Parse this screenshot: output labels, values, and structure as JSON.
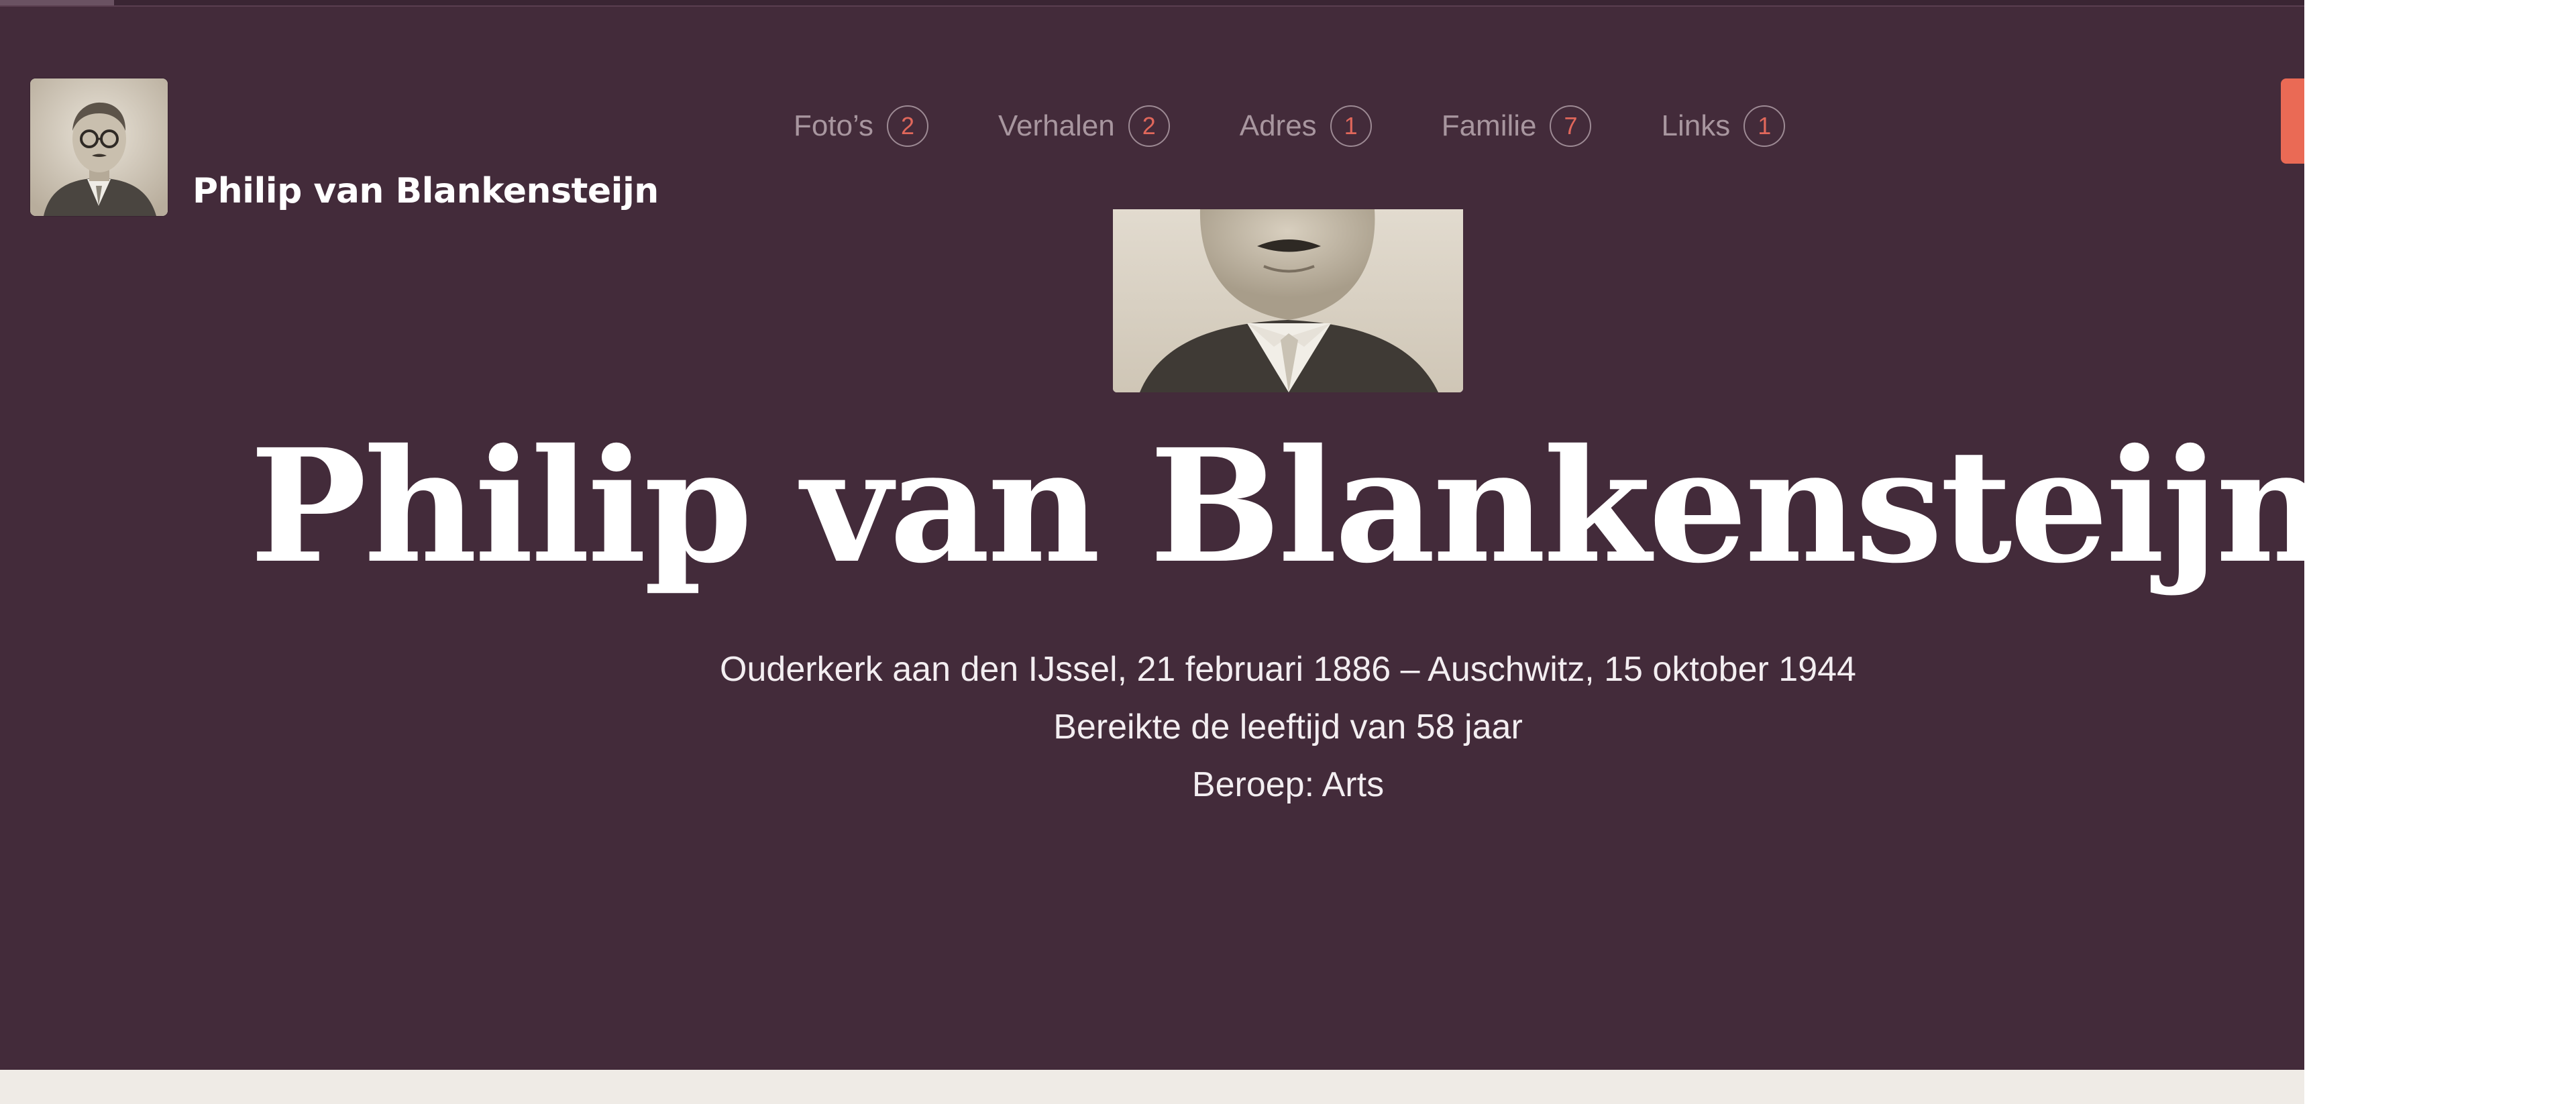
{
  "site": {
    "name": "Philip van Blankensteijn"
  },
  "nav": {
    "items": [
      {
        "label": "Foto’s",
        "count": "2"
      },
      {
        "label": "Verhalen",
        "count": "2"
      },
      {
        "label": "Adres",
        "count": "1"
      },
      {
        "label": "Familie",
        "count": "7"
      },
      {
        "label": "Links",
        "count": "1"
      }
    ]
  },
  "person": {
    "name": "Philip van Blankensteijn",
    "life": "Ouderkerk aan den IJssel, 21 februari 1886 – Auschwitz, 15 oktober 1944",
    "age": "Bereikte de leeftijd van 58 jaar",
    "occupation": "Beroep: Arts"
  },
  "colors": {
    "hero_background": "#432b3a",
    "accent": "#ea6a55",
    "count_text": "#e0675b",
    "footer_strip": "#efebe6"
  },
  "icons": {
    "avatar": "portrait-photo-icon",
    "portrait": "portrait-photo"
  }
}
